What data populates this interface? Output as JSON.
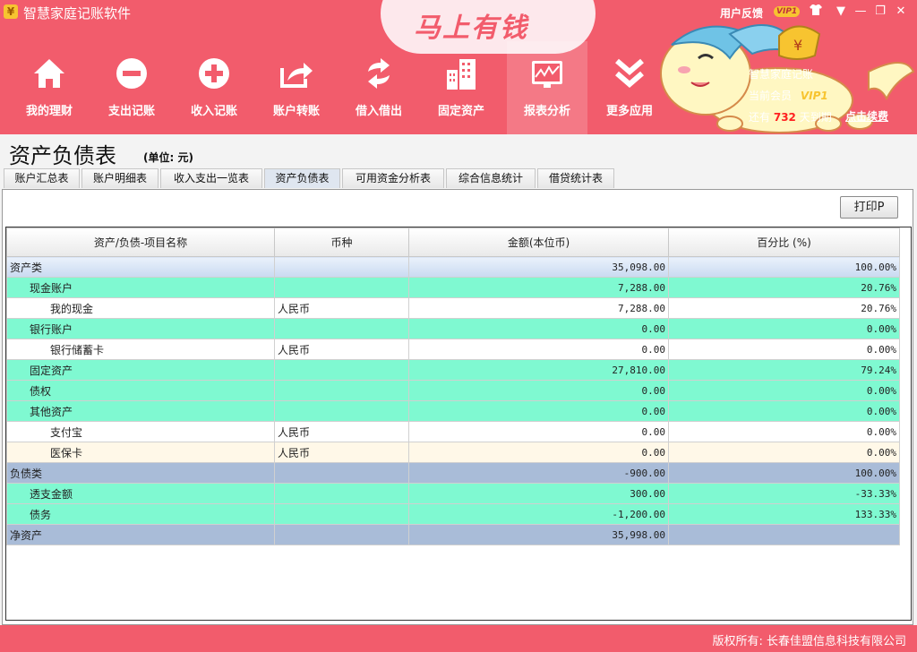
{
  "window": {
    "title": "智慧家庭记账软件",
    "feedback": "用户反馈",
    "vip": "VIP1",
    "controls": [
      "▼",
      "—",
      "❐",
      "✕"
    ]
  },
  "slogan": "马上有钱",
  "toolbar": [
    {
      "label": "我的理财",
      "icon": "home-icon"
    },
    {
      "label": "支出记账",
      "icon": "minus-icon"
    },
    {
      "label": "收入记账",
      "icon": "plus-icon"
    },
    {
      "label": "账户转账",
      "icon": "transfer-icon"
    },
    {
      "label": "借入借出",
      "icon": "refresh-icon"
    },
    {
      "label": "固定资产",
      "icon": "building-icon"
    },
    {
      "label": "报表分析",
      "icon": "chart-icon"
    },
    {
      "label": "更多应用",
      "icon": "double-chevron-icon"
    }
  ],
  "user_panel": {
    "line1": "智慧家庭记账",
    "line2": "当前会员",
    "vip": "VIP1",
    "line3_prefix": "还有",
    "days": "732",
    "line3_suffix": "天到期",
    "renew": "点击续费"
  },
  "report": {
    "title": "资产负债表",
    "unit": "(单位: 元)",
    "print": "打印P"
  },
  "tabs": [
    "账户汇总表",
    "账户明细表",
    "收入支出一览表",
    "资产负债表",
    "可用资金分析表",
    "综合信息统计",
    "借贷统计表"
  ],
  "table": {
    "headers": [
      "资产/负债-项目名称",
      "币种",
      "金额(本位币)",
      "百分比 (%)"
    ],
    "rows": [
      {
        "name": "资产类",
        "currency": "",
        "amount": "35,098.00",
        "pct": "100.00%",
        "type": "cat-asset",
        "level": 0
      },
      {
        "name": "现金账户",
        "currency": "",
        "amount": "7,288.00",
        "pct": "20.76%",
        "type": "grp",
        "level": 1
      },
      {
        "name": "我的现金",
        "currency": "人民币",
        "amount": "7,288.00",
        "pct": "20.76%",
        "type": "leaf",
        "level": 2
      },
      {
        "name": "银行账户",
        "currency": "",
        "amount": "0.00",
        "pct": "0.00%",
        "type": "grp",
        "level": 1
      },
      {
        "name": "银行储蓄卡",
        "currency": "人民币",
        "amount": "0.00",
        "pct": "0.00%",
        "type": "leaf",
        "level": 2
      },
      {
        "name": "固定资产",
        "currency": "",
        "amount": "27,810.00",
        "pct": "79.24%",
        "type": "grp",
        "level": 1
      },
      {
        "name": "债权",
        "currency": "",
        "amount": "0.00",
        "pct": "0.00%",
        "type": "grp",
        "level": 1
      },
      {
        "name": "其他资产",
        "currency": "",
        "amount": "0.00",
        "pct": "0.00%",
        "type": "grp",
        "level": 1
      },
      {
        "name": "支付宝",
        "currency": "人民币",
        "amount": "0.00",
        "pct": "0.00%",
        "type": "leaf",
        "level": 2
      },
      {
        "name": "医保卡",
        "currency": "人民币",
        "amount": "0.00",
        "pct": "0.00%",
        "type": "leaf-alt",
        "level": 2
      },
      {
        "name": "负债类",
        "currency": "",
        "amount": "-900.00",
        "pct": "100.00%",
        "type": "cat-liab",
        "level": 0
      },
      {
        "name": "透支金额",
        "currency": "",
        "amount": "300.00",
        "pct": "-33.33%",
        "type": "grp",
        "level": 1
      },
      {
        "name": "债务",
        "currency": "",
        "amount": "-1,200.00",
        "pct": "133.33%",
        "type": "grp",
        "level": 1
      },
      {
        "name": "净资产",
        "currency": "",
        "amount": "35,998.00",
        "pct": "",
        "type": "cat-net",
        "level": 0
      }
    ]
  },
  "footer": {
    "copyright": "版权所有: 长春佳盟信息科技有限公司"
  },
  "colors": {
    "brand": "#f25c6c",
    "group_row": "#7ff9d1",
    "category_row": "#a9bcd8"
  }
}
